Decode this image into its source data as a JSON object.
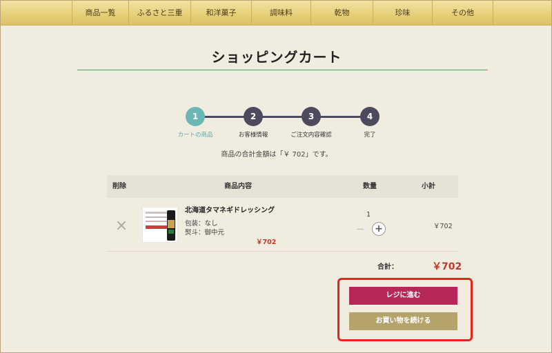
{
  "nav": {
    "items": [
      "商品一覧",
      "ふるさと三重",
      "和洋菓子",
      "調味料",
      "乾物",
      "珍味",
      "その他"
    ]
  },
  "page": {
    "title": "ショッピングカート"
  },
  "steps": [
    {
      "number": "1",
      "label": "カートの商品",
      "active": true
    },
    {
      "number": "2",
      "label": "お客様情報",
      "active": false
    },
    {
      "number": "3",
      "label": "ご注文内容確認",
      "active": false
    },
    {
      "number": "4",
      "label": "完了",
      "active": false
    }
  ],
  "summary": "商品の合計金額は「￥ 702」です。",
  "table": {
    "headers": {
      "remove": "削除",
      "product": "商品内容",
      "quantity": "数量",
      "subtotal": "小計"
    },
    "rows": [
      {
        "name": "北海道タマネギドレッシング",
        "options": [
          "包装：なし",
          "熨斗：御中元"
        ],
        "price": "￥702",
        "quantity": "1",
        "subtotal": "￥702"
      }
    ]
  },
  "total": {
    "label": "合計：",
    "value": "￥702"
  },
  "buttons": {
    "checkout": "レジに進む",
    "continue": "お買い物を続ける"
  },
  "colors": {
    "accent_active_step": "#6ab7b5",
    "step_inactive": "#4e4a5e",
    "price_red": "#c0392b",
    "checkout_button": "#b8275a",
    "continue_button": "#b4a46c",
    "highlight_outline": "#e8241e"
  },
  "icons": {
    "remove": "close-x-icon",
    "plus": "plus-circle-icon",
    "minus": "minus-icon"
  }
}
